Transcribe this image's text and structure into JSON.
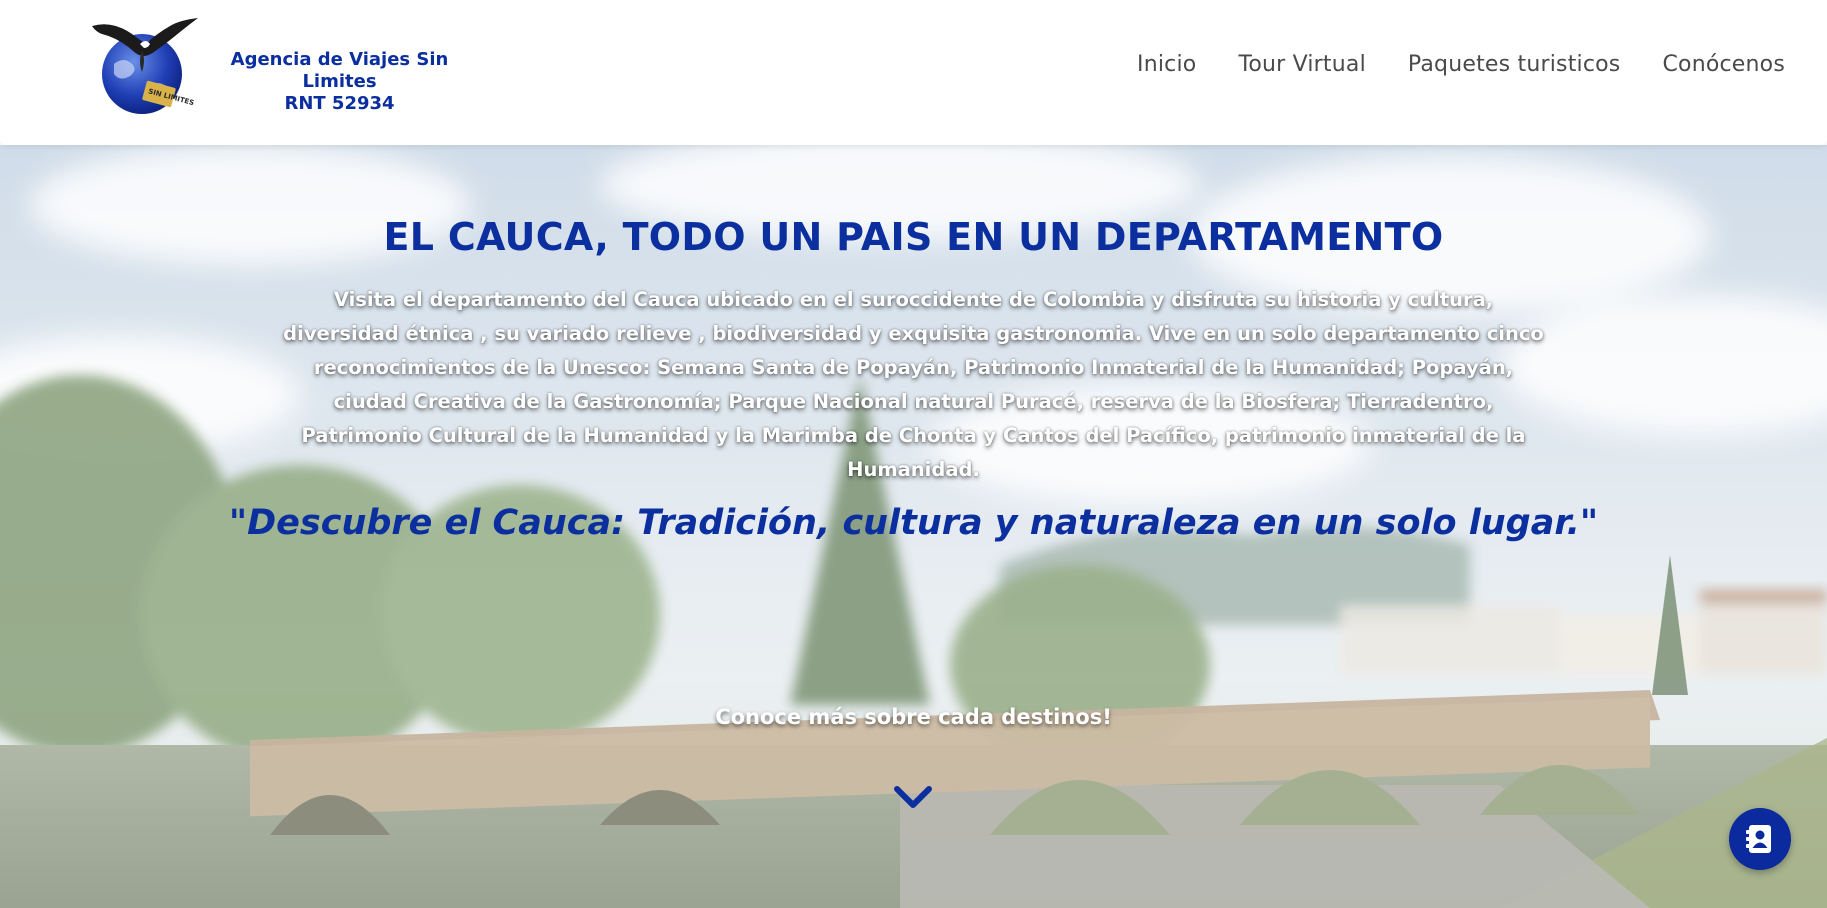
{
  "logo": {
    "line1": "Agencia de Viajes Sin Limites",
    "line2": "RNT 52934",
    "badge": "SIN LIMITES"
  },
  "nav": {
    "items": [
      {
        "label": "Inicio"
      },
      {
        "label": "Tour Virtual"
      },
      {
        "label": "Paquetes turisticos"
      },
      {
        "label": "Conócenos"
      }
    ]
  },
  "hero": {
    "title": "EL CAUCA, TODO UN PAIS EN UN DEPARTAMENTO",
    "description": "Visita el departamento del Cauca ubicado en el suroccidente de Colombia y disfruta su historia y cultura, diversidad étnica , su variado relieve , biodiversidad y exquisita gastronomia. Vive en un solo departamento cinco reconocimientos de la Unesco: Semana Santa de Popayán, Patrimonio Inmaterial de la Humanidad; Popayán, ciudad Creativa de la Gastronomía; Parque Nacional natural Puracé, reserva de la Biosfera; Tierradentro, Patrimonio Cultural de la Humanidad y la Marimba de Chonta y Cantos del Pacífico, patrimonio inmaterial de la Humanidad.",
    "quote": "\"Descubre el Cauca: Tradición, cultura y naturaleza en un solo lugar.\"",
    "more_label": "Conoce más sobre cada destinos!"
  },
  "icons": {
    "scroll": "chevron-down-icon",
    "contact": "contact-card-icon"
  },
  "colors": {
    "brand_blue": "#0b2f9e",
    "nav_text": "#4a4a4a",
    "contact_button": "#0a2a9e"
  }
}
